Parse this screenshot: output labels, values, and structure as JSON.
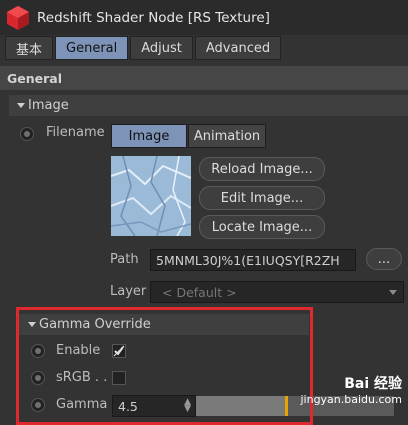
{
  "window": {
    "title": "Redshift Shader Node [RS Texture]"
  },
  "tabs": [
    {
      "label": "基本",
      "active": false
    },
    {
      "label": "General",
      "active": true
    },
    {
      "label": "Adjust",
      "active": false
    },
    {
      "label": "Advanced",
      "active": false
    }
  ],
  "section": {
    "title": "General"
  },
  "image_group": {
    "header": "Image",
    "filename_label": "Filename",
    "mode_tabs": [
      {
        "label": "Image",
        "active": true
      },
      {
        "label": "Animation",
        "active": false
      }
    ],
    "buttons": {
      "reload": "Reload Image...",
      "edit": "Edit Image...",
      "locate": "Locate Image..."
    },
    "path_label": "Path",
    "path_value": "5MNML30J%1(E1IUQSY[R2ZH",
    "browse_label": "...",
    "layer_label": "Layer",
    "layer_value": "< Default >"
  },
  "gamma_group": {
    "header": "Gamma Override",
    "enable_label": "Enable",
    "enable_checked": true,
    "srgb_label": "sRGB . .",
    "srgb_checked": false,
    "gamma_label": "Gamma",
    "gamma_value": "4.5",
    "gamma_slider_fraction": 0.45
  },
  "watermark": {
    "text": "Bai 经验",
    "url": "jingyan.baidu.com"
  },
  "colors": {
    "accent_tab": "#7d93b7",
    "highlight_box": "#e0282f",
    "slider_knob": "#e8a400"
  }
}
